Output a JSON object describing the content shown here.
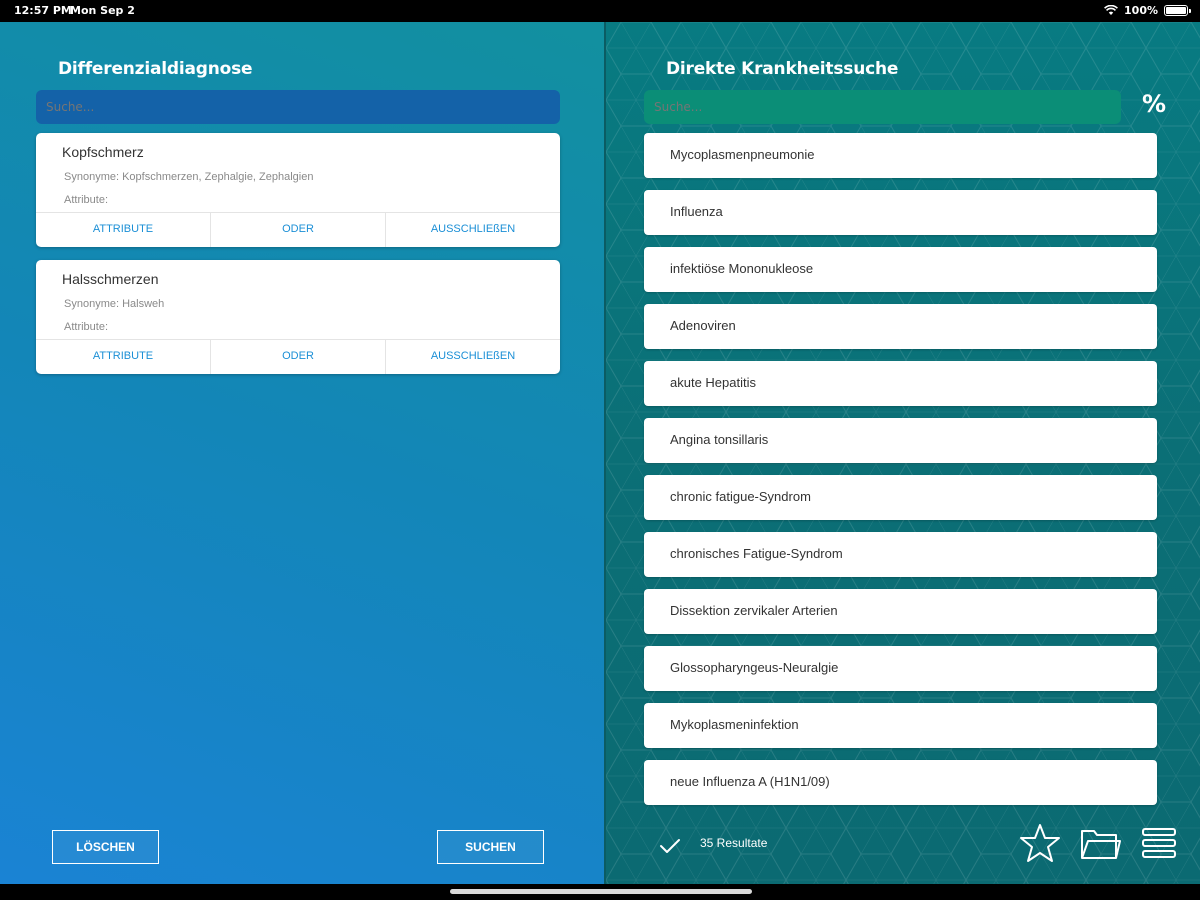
{
  "status_bar": {
    "time": "12:57 PM",
    "date": "Mon Sep 2",
    "battery": "100%"
  },
  "left": {
    "title": "Differenzialdiagnose",
    "search_placeholder": "Suche...",
    "symptoms": [
      {
        "name": "Kopfschmerz",
        "synonyms": "Synonyme: Kopfschmerzen, Zephalgie, Zephalgien",
        "attributes": "Attribute:",
        "actions": [
          "ATTRIBUTE",
          "ODER",
          "AUSSCHLIEßEN"
        ]
      },
      {
        "name": "Halsschmerzen",
        "synonyms": "Synonyme: Halsweh",
        "attributes": "Attribute:",
        "actions": [
          "ATTRIBUTE",
          "ODER",
          "AUSSCHLIEßEN"
        ]
      }
    ],
    "clear_label": "LÖSCHEN",
    "search_label": "SUCHEN"
  },
  "right": {
    "title": "Direkte Krankheitssuche",
    "search_placeholder": "Suche...",
    "percent_label": "%",
    "results": [
      "Mycoplasmenpneumonie",
      "Influenza",
      "infektiöse Mononukleose",
      "Adenoviren",
      "akute Hepatitis",
      "Angina tonsillaris",
      "chronic fatigue-Syndrom",
      "chronisches Fatigue-Syndrom",
      "Dissektion zervikaler Arterien",
      "Glossopharyngeus-Neuralgie",
      "Mykoplasmeninfektion",
      "neue Influenza A (H1N1/09)"
    ],
    "results_count": "35 Resultate"
  },
  "icons": [
    "wifi-icon",
    "battery-icon",
    "check-icon",
    "star-icon",
    "folder-icon",
    "menu-icon"
  ],
  "colors": {
    "accent_blue": "#1b8fd6",
    "left_bg": "#1386b8",
    "right_bg": "#0b6f76",
    "right_search": "#0b8e77"
  }
}
